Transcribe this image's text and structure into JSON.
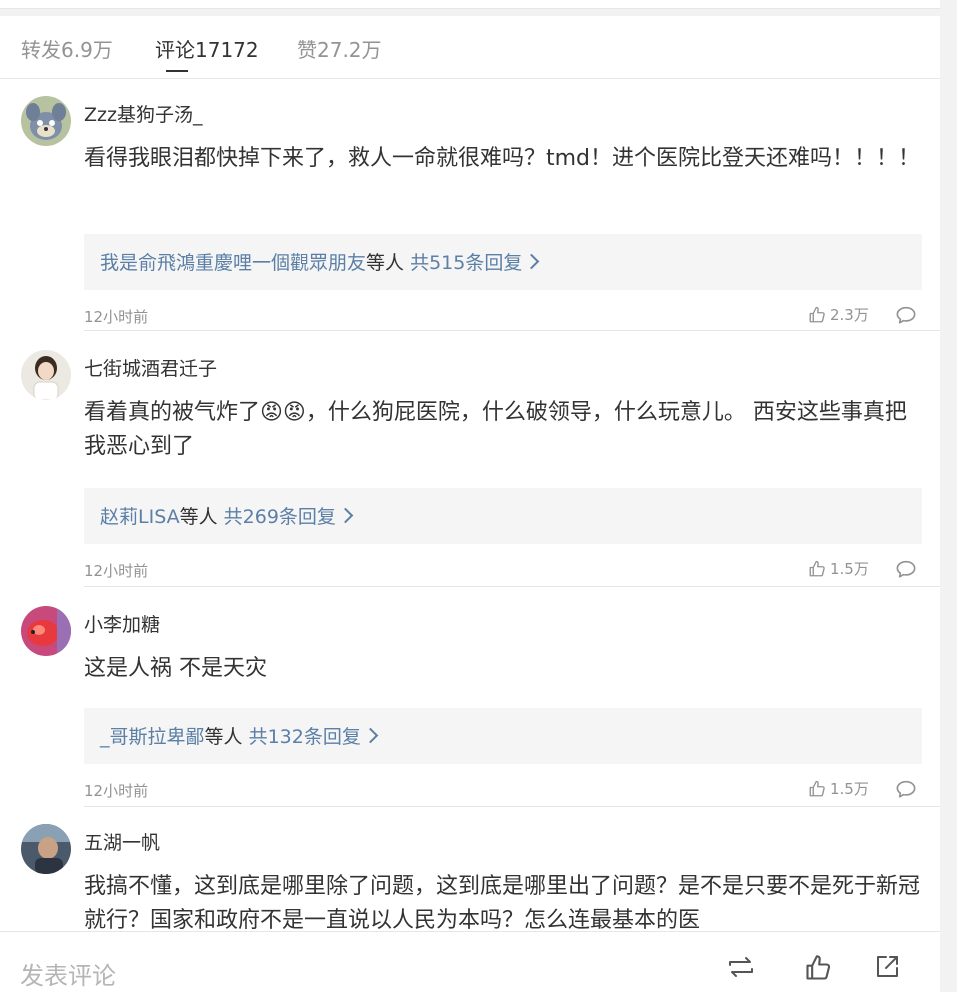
{
  "tabs": [
    {
      "label": "转发6.9万"
    },
    {
      "label": "评论17172"
    },
    {
      "label": "赞27.2万"
    }
  ],
  "comments": [
    {
      "username": "Zzz基狗子汤_",
      "text": "看得我眼泪都快掉下来了，救人一命就很难吗？tmd！进个医院比登天还难吗！！！！",
      "replies_users": "我是俞飛鴻重慶哩一個觀眾朋友",
      "replies_suffix": "等人",
      "replies_count": "共515条回复",
      "time": "12小时前",
      "likes": "2.3万"
    },
    {
      "username": "七街城酒君迁子",
      "text": "看着真的被气炸了😡😡，什么狗屁医院，什么破领导，什么玩意儿。 西安这些事真把我恶心到了",
      "replies_users": "赵莉LISA",
      "replies_suffix": "等人",
      "replies_count": "共269条回复",
      "time": "12小时前",
      "likes": "1.5万"
    },
    {
      "username": "小李加糖",
      "text": "这是人祸 不是天灾",
      "replies_users": "_哥斯拉卑鄙",
      "replies_suffix": "等人",
      "replies_count": "共132条回复",
      "time": "12小时前",
      "likes": "1.5万"
    },
    {
      "username": "五湖一帆",
      "text": "我搞不懂，这到底是哪里除了问题，这到底是哪里出了问题？是不是只要不是死于新冠就行？国家和政府不是一直说以人民为本吗？怎么连最基本的医"
    }
  ],
  "bottom": {
    "placeholder": "发表评论"
  },
  "icons": {
    "like": "thumbs-up-icon",
    "reply": "speech-bubble-icon",
    "repost": "repost-icon",
    "share": "share-icon"
  },
  "colors": {
    "link": "#5b7fa6",
    "muted": "#939393",
    "reply_box": "#f5f5f5"
  }
}
